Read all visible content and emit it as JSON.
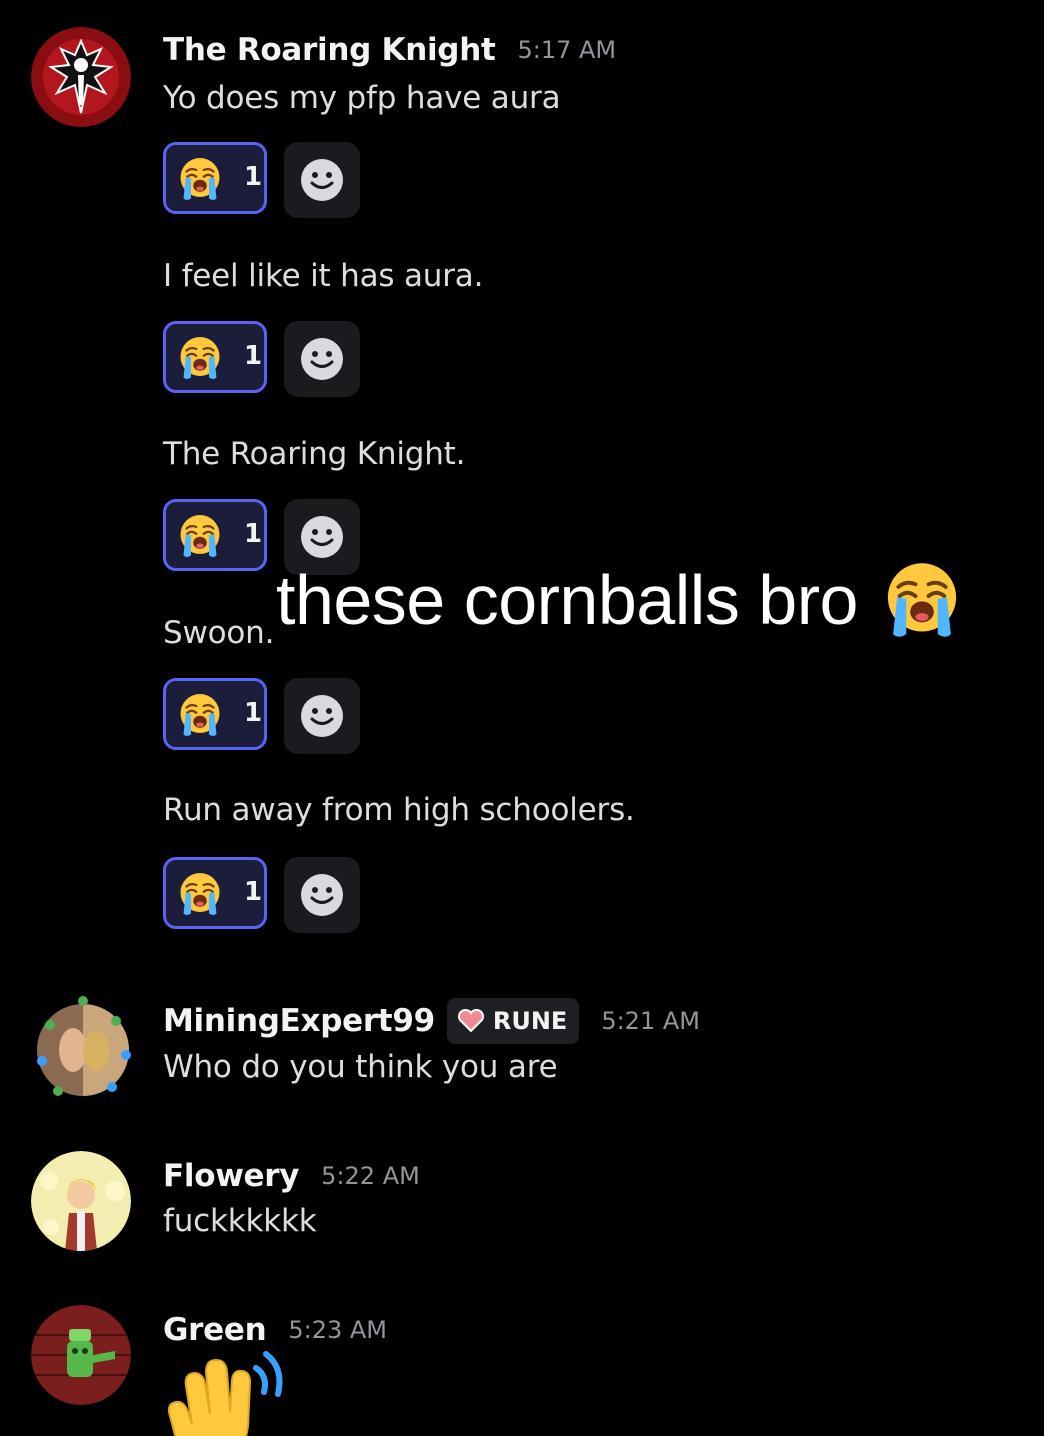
{
  "messages": [
    {
      "author": "The Roaring Knight",
      "time": "5:17 AM",
      "lines": [
        {
          "text": "Yo does my pfp have aura",
          "reaction_count": "1"
        },
        {
          "text": "I feel like it has aura.",
          "reaction_count": "1"
        },
        {
          "text": "The Roaring Knight.",
          "reaction_count": "1"
        },
        {
          "text": "Swoon.",
          "reaction_count": "1"
        },
        {
          "text": "Run away from high schoolers.",
          "reaction_count": "1"
        }
      ]
    },
    {
      "author": "MiningExpert99",
      "badge": "RUNE",
      "time": "5:21 AM",
      "text": "Who do you think you are"
    },
    {
      "author": "Flowery",
      "time": "5:22 AM",
      "text": "fuckkkkkk"
    },
    {
      "author": "Green",
      "time": "5:23 AM",
      "emoji": "waving-hand"
    }
  ],
  "overlay": {
    "text": "these cornballs bro",
    "emoji": "loudly-crying-face"
  },
  "reaction_emoji": "loudly-crying-face",
  "colors": {
    "background": "#000000",
    "reaction_border": "#5865f2",
    "reaction_bg": "#1b1d3b",
    "timestamp": "#93959c"
  }
}
